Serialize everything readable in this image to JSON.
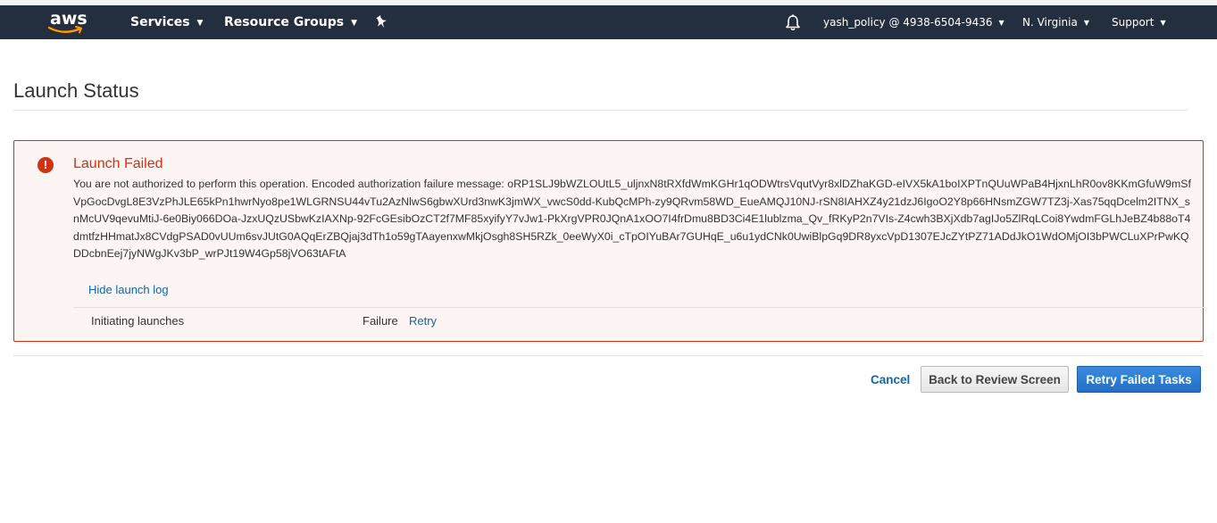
{
  "navbar": {
    "logo_text": "aws",
    "services_label": "Services",
    "resource_groups_label": "Resource Groups",
    "account_label": "yash_policy @ 4938-6504-9436",
    "region_label": "N. Virginia",
    "support_label": "Support",
    "caret": "▼",
    "icons": [
      "pin-icon",
      "bell-icon"
    ]
  },
  "page": {
    "title": "Launch Status"
  },
  "alert": {
    "status_color": "#d13212",
    "icon_glyph": "!",
    "title": "Launch Failed",
    "message": "You are not authorized to perform this operation. Encoded authorization failure message: oRP1SLJ9bWZLOUtL5_uljnxN8tRXfdWmKGHr1qODWtrsVqutVyr8xlDZhaKGD-eIVX5kA1boIXPTnQUuWPaB4HjxnLhR0ov8KKmGfuW9mSfVpGocDvgL8E3VzPhJLE65kPn1hwrNyo8pe1WLGRNSU44vTu2AzNlwS6gbwXUrd3nwK3jmWX_vwcS0dd-KubQcMPh-zy9QRvm58WD_EueAMQJ10NJ-rSN8IAHXZ4y21dzJ6IgoO2Y8p66HNsmZGW7TZ3j-Xas75qqDcelm2ITNX_snMcUV9qevuMtiJ-6e0Biy066DOa-JzxUQzUSbwKzIAXNp-92FcGEsibOzCT2f7MF85xyifyY7vJw1-PkXrgVPR0JQnA1xOO7I4frDmu8BD3Ci4E1lublzma_Qv_fRKyP2n7VIs-Z4cwh3BXjXdb7agIJo5ZlRqLCoi8YwdmFGLhJeBZ4b88oT4dmtfzHHmatJx8CVdgPSAD0vUUm6svJUtG0AQqErZBQjaj3dTh1o59gTAayenxwMkjOsgh8SH5RZk_0eeWyX0i_cTpOIYuBAr7GUHqE_u6u1ydCNk0UwiBlpGq9DR8yxcVpD1307EJcZYtPZ71ADdJkO1WdOMjOI3bPWCLuXPrPwKQDDcbnEej7jyNWgJKv3bP_wrPJt19W4Gp58jVO63tAFtA",
    "hide_log_label": "Hide launch log",
    "log": {
      "label": "Initiating launches",
      "status": "Failure",
      "retry_label": "Retry"
    }
  },
  "footer": {
    "cancel_label": "Cancel",
    "back_label": "Back to Review Screen",
    "retry_failed_label": "Retry Failed Tasks"
  },
  "colors": {
    "navbar_bg": "#232f3e",
    "link": "#1266ab",
    "primary_button": "#236fc6",
    "error": "#d13212"
  }
}
